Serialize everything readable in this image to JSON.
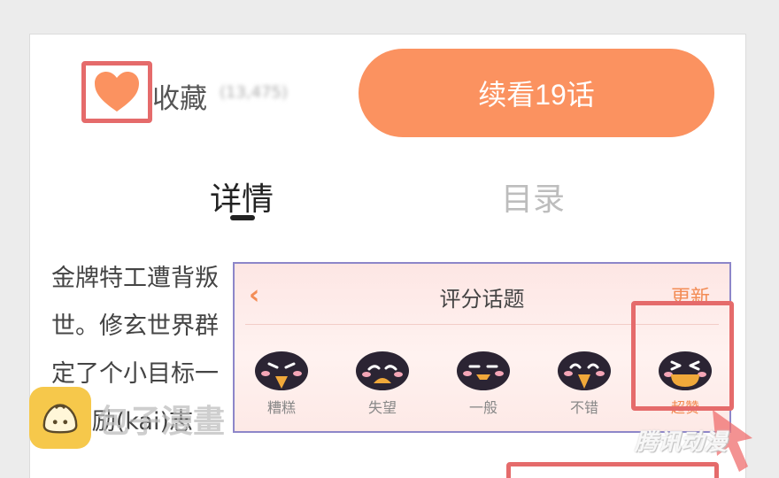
{
  "favorite": {
    "label": "收藏",
    "count": "(13,475)"
  },
  "continue_button": "续看19话",
  "tabs": [
    {
      "label": "详情",
      "active": true
    },
    {
      "label": "目录",
      "active": false
    }
  ],
  "description": [
    "金牌特工遭背叛",
    "世。修玄世界群",
    "定了个小目标一",
    "(bi)励(kai)志"
  ],
  "watermark": {
    "site": "包子漫畫",
    "brand": "腾讯动漫"
  },
  "rating_popup": {
    "title": "评分话题",
    "refresh": "更新",
    "options": [
      {
        "label": "糟糕",
        "icon": "face-bad-icon"
      },
      {
        "label": "失望",
        "icon": "face-disappointed-icon"
      },
      {
        "label": "一般",
        "icon": "face-ok-icon"
      },
      {
        "label": "不错",
        "icon": "face-good-icon"
      },
      {
        "label": "超赞",
        "icon": "face-awesome-icon",
        "selected": true
      }
    ]
  },
  "colors": {
    "accent": "#fb9260",
    "highlight": "#e56b6b",
    "popup_border": "#8d86c9"
  }
}
